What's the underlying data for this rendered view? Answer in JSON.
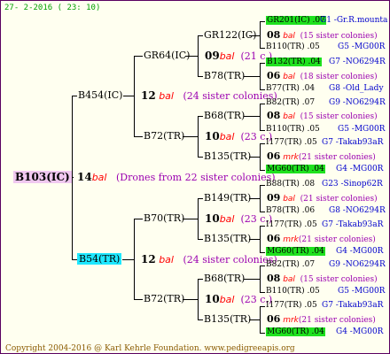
{
  "header": {
    "date": "27-  2-2016 ( 23: 10)"
  },
  "footer": {
    "copyright": "Copyright 2004-2016 @ Karl Kehrle Foundation.   www.pedigreeapis.org"
  },
  "root": {
    "id": "B103(IC)",
    "year": "14",
    "mark": "bal",
    "note": "(Drones from 22 sister colonies)"
  },
  "gen1": [
    {
      "id": "B454(IC)",
      "year": "12",
      "mark": "bal",
      "note": "(24 sister colonies)"
    },
    {
      "id": "B54(TR)",
      "year": "12",
      "mark": "bal",
      "note": "(24 sister colonies)"
    }
  ],
  "gen2": [
    {
      "id": "GR64(IC)",
      "year": "09",
      "mark": "bal",
      "note": "(21 c.)"
    },
    {
      "id": "B72(TR)",
      "year": "10",
      "mark": "bal",
      "note": "(23 c.)"
    },
    {
      "id": "B70(TR)",
      "year": "10",
      "mark": "bal",
      "note": "(23 c.)"
    },
    {
      "id": "B72(TR)",
      "year": "10",
      "mark": "bal",
      "note": "(23 c.)"
    }
  ],
  "gen3": [
    {
      "id": "GR122(IC)",
      "year": "08",
      "mark": "bal",
      "note": "(15 sister colonies)"
    },
    {
      "id": "B78(TR)",
      "year": "06",
      "mark": "bal",
      "note": "(18 sister colonies)"
    },
    {
      "id": "B68(TR)",
      "year": "08",
      "mark": "bal",
      "note": "(15 sister colonies)"
    },
    {
      "id": "B135(TR)",
      "year": "06",
      "mark": "mrk",
      "note": "(21 sister colonies)"
    },
    {
      "id": "B149(TR)",
      "year": "09",
      "mark": "bal",
      "note": "(21 sister colonies)"
    },
    {
      "id": "B135(TR)",
      "year": "06",
      "mark": "mrk",
      "note": "(21 sister colonies)"
    },
    {
      "id": "B68(TR)",
      "year": "08",
      "mark": "bal",
      "note": "(15 sister colonies)"
    },
    {
      "id": "B135(TR)",
      "year": "06",
      "mark": "mrk",
      "note": "(21 sister colonies)"
    }
  ],
  "gen4": [
    {
      "left": "GR201(IC) .07",
      "right": "G1 -Gr.R.mounta"
    },
    {
      "left": "B110(TR) .05",
      "right": "G5 -MG00R"
    },
    {
      "left": "B132(TR) .04",
      "right": "G7 -NO6294R"
    },
    {
      "left": "B77(TR) .04",
      "right": "G8 -Old_Lady"
    },
    {
      "left": "B82(TR) .07",
      "right": "G9 -NO6294R"
    },
    {
      "left": "B110(TR) .05",
      "right": "G5 -MG00R"
    },
    {
      "left": "I177(TR) .05",
      "right": "G7 -Takab93aR"
    },
    {
      "left": "MG60(TR) .04",
      "right": "G4 -MG00R"
    },
    {
      "left": "B88(TR) .08",
      "right": "G23 -Sinop62R"
    },
    {
      "left": "B78(TR) .06",
      "right": "G8 -NO6294R"
    },
    {
      "left": "I177(TR) .05",
      "right": "G7 -Takab93aR"
    },
    {
      "left": "MG60(TR) .04",
      "right": "G4 -MG00R"
    },
    {
      "left": "B82(TR) .07",
      "right": "G9 -NO6294R"
    },
    {
      "left": "B110(TR) .05",
      "right": "G5 -MG00R"
    },
    {
      "left": "I177(TR) .05",
      "right": "G7 -Takab93aR"
    },
    {
      "left": "MG60(TR) .04",
      "right": "G4 -MG00R"
    }
  ],
  "colors": {
    "highlight": "#1fe21f",
    "root_bg": "#f0c8f0",
    "mother_bg": "#1ee8ff",
    "mark": "#ff0000",
    "sister": "#9b00b0",
    "gr": "#0000cc"
  }
}
